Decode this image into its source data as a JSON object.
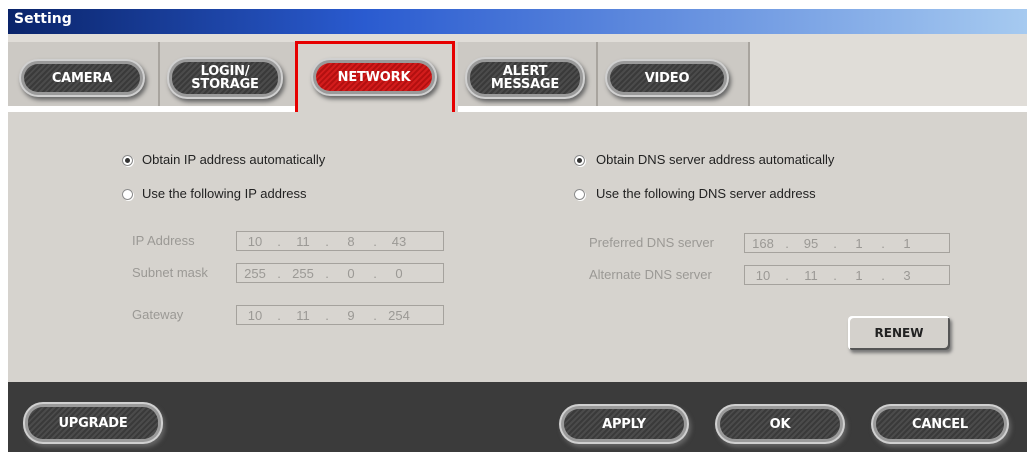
{
  "window": {
    "title": "Setting"
  },
  "tabs": [
    {
      "label": "CAMERA"
    },
    {
      "label": "LOGIN/\nSTORAGE"
    },
    {
      "label": "NETWORK",
      "active": true
    },
    {
      "label": "ALERT\nMESSAGE"
    },
    {
      "label": "VIDEO"
    }
  ],
  "ip": {
    "auto_label": "Obtain IP address automatically",
    "manual_label": "Use the following IP address",
    "selected": "auto",
    "fields": [
      {
        "label": "IP Address",
        "octets": [
          "10",
          "11",
          "8",
          "43"
        ]
      },
      {
        "label": "Subnet mask",
        "octets": [
          "255",
          "255",
          "0",
          "0"
        ]
      },
      {
        "label": "Gateway",
        "octets": [
          "10",
          "11",
          "9",
          "254"
        ]
      }
    ]
  },
  "dns": {
    "auto_label": "Obtain DNS server address automatically",
    "manual_label": "Use the following DNS server address",
    "selected": "auto",
    "fields": [
      {
        "label": "Preferred DNS server",
        "octets": [
          "168",
          "95",
          "1",
          "1"
        ]
      },
      {
        "label": "Alternate DNS server",
        "octets": [
          "10",
          "11",
          "1",
          "3"
        ]
      }
    ]
  },
  "buttons": {
    "renew": "RENEW",
    "upgrade": "UPGRADE",
    "apply": "APPLY",
    "ok": "OK",
    "cancel": "CANCEL"
  },
  "colors": {
    "active_tab": "#c8181a",
    "highlight": "#e60000"
  }
}
